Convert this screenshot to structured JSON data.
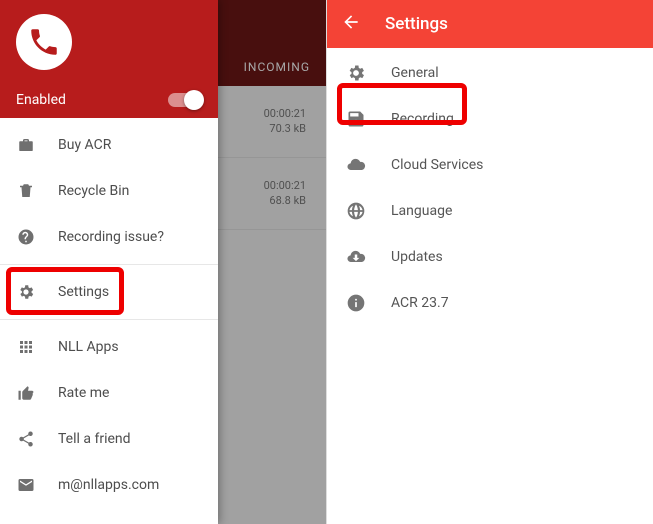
{
  "left": {
    "tab_label": "INCOMING",
    "enabled_label": "Enabled",
    "bg_rows": [
      {
        "time": "00:00:21",
        "size": "70.3 kB"
      },
      {
        "time": "00:00:21",
        "size": "68.8 kB"
      }
    ],
    "items": [
      {
        "label": "Buy ACR"
      },
      {
        "label": "Recycle Bin"
      },
      {
        "label": "Recording issue?"
      },
      {
        "label": "Settings"
      },
      {
        "label": "NLL Apps"
      },
      {
        "label": "Rate me"
      },
      {
        "label": "Tell a friend"
      },
      {
        "label": "m@nllapps.com"
      }
    ]
  },
  "right": {
    "title": "Settings",
    "items": [
      {
        "label": "General"
      },
      {
        "label": "Recording"
      },
      {
        "label": "Cloud Services"
      },
      {
        "label": "Language"
      },
      {
        "label": "Updates"
      },
      {
        "label": "ACR 23.7"
      }
    ]
  }
}
